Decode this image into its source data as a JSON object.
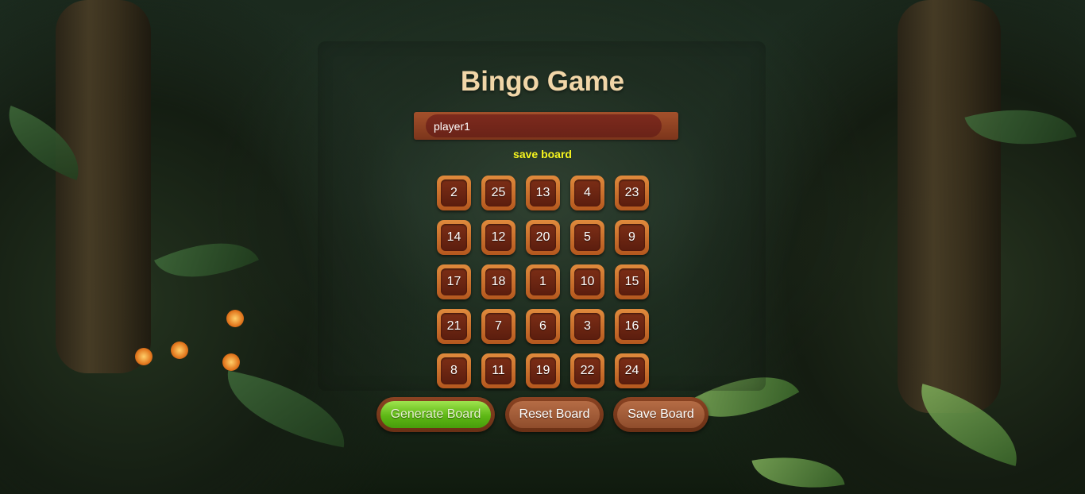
{
  "game": {
    "title": "Bingo Game",
    "player_name_value": "player1",
    "save_link_label": "save board",
    "board": [
      [
        2,
        25,
        13,
        4,
        23
      ],
      [
        14,
        12,
        20,
        5,
        9
      ],
      [
        17,
        18,
        1,
        10,
        15
      ],
      [
        21,
        7,
        6,
        3,
        16
      ],
      [
        8,
        11,
        19,
        22,
        24
      ]
    ],
    "buttons": {
      "generate": "Generate Board",
      "reset": "Reset Board",
      "save": "Save Board"
    }
  },
  "colors": {
    "title": "#f1d6a8",
    "save_link": "#f6f51e",
    "tile_frame": "#e08a3c",
    "tile_center": "#7c2e16",
    "primary_button": "#5eb715"
  }
}
